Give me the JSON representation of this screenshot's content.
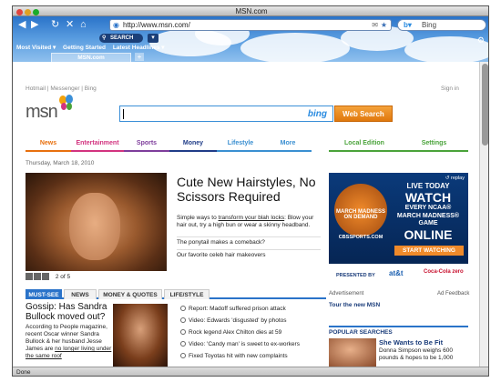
{
  "window": {
    "title": "MSN.com"
  },
  "toolbar": {
    "url": "http://www.msn.com/",
    "search_engine": "Bing",
    "search_pill": "SEARCH",
    "bookmarks": [
      "Most Visited ▾",
      "Getting Started",
      "Latest Headlines ▾"
    ],
    "tab_title": "MSN.com",
    "new_tab": "+"
  },
  "page": {
    "top_links": "Hotmail | Messenger | Bing",
    "sign_in": "Sign in",
    "logo_text": "msn",
    "search_button": "Web Search",
    "bing_label": "bing",
    "nav": [
      {
        "label": "News",
        "color": "#e8700e"
      },
      {
        "label": "Entertainment",
        "color": "#d2337f"
      },
      {
        "label": "Sports",
        "color": "#7e3d9b"
      },
      {
        "label": "Money",
        "color": "#1f3c88"
      },
      {
        "label": "Lifestyle",
        "color": "#3a8fd1"
      },
      {
        "label": "More",
        "color": "#3a8fd1"
      },
      {
        "label": "Local Edition",
        "color": "#4aa33a"
      },
      {
        "label": "Settings",
        "color": "#4aa33a"
      }
    ],
    "date": "Thursday, March 18, 2010",
    "hero": {
      "headline": "Cute New Hairstyles, No Scissors Required",
      "paragraph_prefix": "Simple ways to ",
      "paragraph_link": "transform your blah locks",
      "paragraph_suffix": ": Blow your hair out, try a high bun or wear a skinny headband.",
      "link1": "The ponytail makes a comeback?",
      "link2": "Our favorite celeb hair makeovers",
      "pager": "2 of 5"
    },
    "ad": {
      "replay": "↺ replay",
      "line1": "LIVE TODAY",
      "line2": "WATCH",
      "line3": "EVERY NCAA®",
      "line4": "MARCH MADNESS®",
      "line5": "GAME",
      "line6": "ONLINE",
      "cta": "START WATCHING",
      "presented": "PRESENTED BY",
      "sponsor1": "at&t",
      "sponsor2": "Coca-Cola zero",
      "badge": "MARCH MADNESS ON DEMAND",
      "network": "CBSSPORTS.COM",
      "label": "Advertisement",
      "feedback": "Ad Feedback",
      "tour": "Tour the new MSN"
    },
    "tabs": [
      "MUST-SEE",
      "NEWS",
      "MONEY & QUOTES",
      "LIFE/STYLE"
    ],
    "story": {
      "title": "Gossip: Has Sandra Bullock moved out?",
      "body": "According to People magazine, recent Oscar winner Sandra Bullock & her husband Jesse James are",
      "link": "no longer living under the same roof"
    },
    "bullets": [
      "Report: Madoff suffered prison attack",
      "Video: Edwards 'disgusted' by photos",
      "Rock legend Alex Chilton dies at 59",
      "Video: 'Candy man' is sweet to ex-workers",
      "Fixed Toyotas hit with new complaints"
    ],
    "popular": {
      "header": "POPULAR SEARCHES",
      "title": "She Wants to Be Fit",
      "body": "Donna Simpson weighs 600 pounds & hopes to be 1,000"
    }
  },
  "status": {
    "text": "Done"
  }
}
